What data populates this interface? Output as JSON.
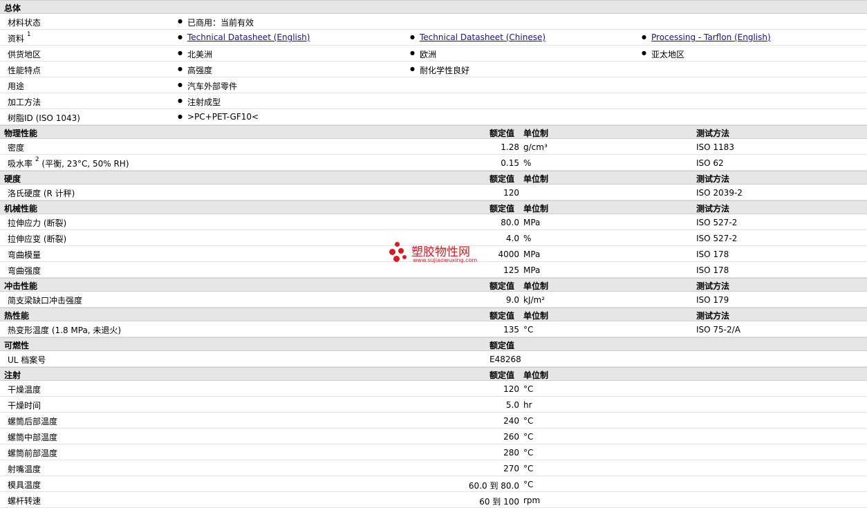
{
  "general": {
    "title": "总体",
    "rows": [
      {
        "label": "材料状态",
        "sup": "",
        "items": [
          {
            "text": "已商用：当前有效",
            "link": false
          }
        ]
      },
      {
        "label": "资料",
        "sup": "1",
        "items": [
          {
            "text": "Technical Datasheet (English)",
            "link": true
          },
          {
            "text": "Technical Datasheet (Chinese)",
            "link": true
          },
          {
            "text": "Processing - Tarflon (English)",
            "link": true
          }
        ]
      },
      {
        "label": "供货地区",
        "sup": "",
        "items": [
          {
            "text": "北美洲",
            "link": false
          },
          {
            "text": "欧洲",
            "link": false
          },
          {
            "text": "亚太地区",
            "link": false
          }
        ]
      },
      {
        "label": "性能特点",
        "sup": "",
        "items": [
          {
            "text": "高强度",
            "link": false
          },
          {
            "text": "耐化学性良好",
            "link": false
          }
        ]
      },
      {
        "label": "用途",
        "sup": "",
        "items": [
          {
            "text": "汽车外部零件",
            "link": false
          }
        ]
      },
      {
        "label": "加工方法",
        "sup": "",
        "items": [
          {
            "text": "注射成型",
            "link": false
          }
        ]
      },
      {
        "label": "树脂ID (ISO 1043)",
        "sup": "",
        "items": [
          {
            "text": ">PC+PET-GF10<",
            "link": false
          }
        ]
      }
    ]
  },
  "headers": {
    "value": "额定值",
    "unit": "单位制",
    "method": "测试方法"
  },
  "sections": [
    {
      "title": "物理性能",
      "show_unit": true,
      "show_method": true,
      "rows": [
        {
          "label": "密度",
          "sup": "",
          "suffix": "",
          "value": "1.28",
          "unit": "g/cm³",
          "method": "ISO 1183"
        },
        {
          "label": "吸水率",
          "sup": "2",
          "suffix": "(平衡, 23°C, 50% RH)",
          "value": "0.15",
          "unit": "%",
          "method": "ISO 62"
        }
      ]
    },
    {
      "title": "硬度",
      "show_unit": true,
      "show_method": true,
      "rows": [
        {
          "label": "洛氏硬度 (R 计秤)",
          "sup": "",
          "suffix": "",
          "value": "120",
          "unit": "",
          "method": "ISO 2039-2"
        }
      ]
    },
    {
      "title": "机械性能",
      "show_unit": true,
      "show_method": true,
      "rows": [
        {
          "label": "拉伸应力 (断裂)",
          "sup": "",
          "suffix": "",
          "value": "80.0",
          "unit": "MPa",
          "method": "ISO 527-2"
        },
        {
          "label": "拉伸应变 (断裂)",
          "sup": "",
          "suffix": "",
          "value": "4.0",
          "unit": "%",
          "method": "ISO 527-2"
        },
        {
          "label": "弯曲模量",
          "sup": "",
          "suffix": "",
          "value": "4000",
          "unit": "MPa",
          "method": "ISO 178"
        },
        {
          "label": "弯曲强度",
          "sup": "",
          "suffix": "",
          "value": "125",
          "unit": "MPa",
          "method": "ISO 178"
        }
      ]
    },
    {
      "title": "冲击性能",
      "show_unit": true,
      "show_method": true,
      "rows": [
        {
          "label": "简支梁缺口冲击强度",
          "sup": "",
          "suffix": "",
          "value": "9.0",
          "unit": "kJ/m²",
          "method": "ISO 179"
        }
      ]
    },
    {
      "title": "热性能",
      "show_unit": true,
      "show_method": true,
      "rows": [
        {
          "label": "热变形温度 (1.8 MPa, 未退火)",
          "sup": "",
          "suffix": "",
          "value": "135",
          "unit": "°C",
          "method": "ISO 75-2/A"
        }
      ]
    },
    {
      "title": "可燃性",
      "show_unit": false,
      "show_method": false,
      "value_left": true,
      "rows": [
        {
          "label": "UL 档案号",
          "sup": "",
          "suffix": "",
          "value": "E48268",
          "unit": "",
          "method": ""
        }
      ]
    },
    {
      "title": "注射",
      "show_unit": true,
      "show_method": false,
      "rows": [
        {
          "label": "干燥温度",
          "sup": "",
          "suffix": "",
          "value": "120",
          "unit": "°C",
          "method": ""
        },
        {
          "label": "干燥时间",
          "sup": "",
          "suffix": "",
          "value": "5.0",
          "unit": "hr",
          "method": ""
        },
        {
          "label": "螺筒后部温度",
          "sup": "",
          "suffix": "",
          "value": "240",
          "unit": "°C",
          "method": ""
        },
        {
          "label": "螺筒中部温度",
          "sup": "",
          "suffix": "",
          "value": "260",
          "unit": "°C",
          "method": ""
        },
        {
          "label": "螺筒前部温度",
          "sup": "",
          "suffix": "",
          "value": "280",
          "unit": "°C",
          "method": ""
        },
        {
          "label": "射嘴温度",
          "sup": "",
          "suffix": "",
          "value": "270",
          "unit": "°C",
          "method": ""
        },
        {
          "label": "模具温度",
          "sup": "",
          "suffix": "",
          "value": "60.0 到 80.0",
          "unit": "°C",
          "method": ""
        },
        {
          "label": "螺杆转速",
          "sup": "",
          "suffix": "",
          "value": "60 到 100",
          "unit": "rpm",
          "method": ""
        }
      ]
    }
  ],
  "watermark": {
    "brand": "塑胶物性网",
    "url": "www.sujiaowuxing.com",
    "color": "#e0181e"
  }
}
